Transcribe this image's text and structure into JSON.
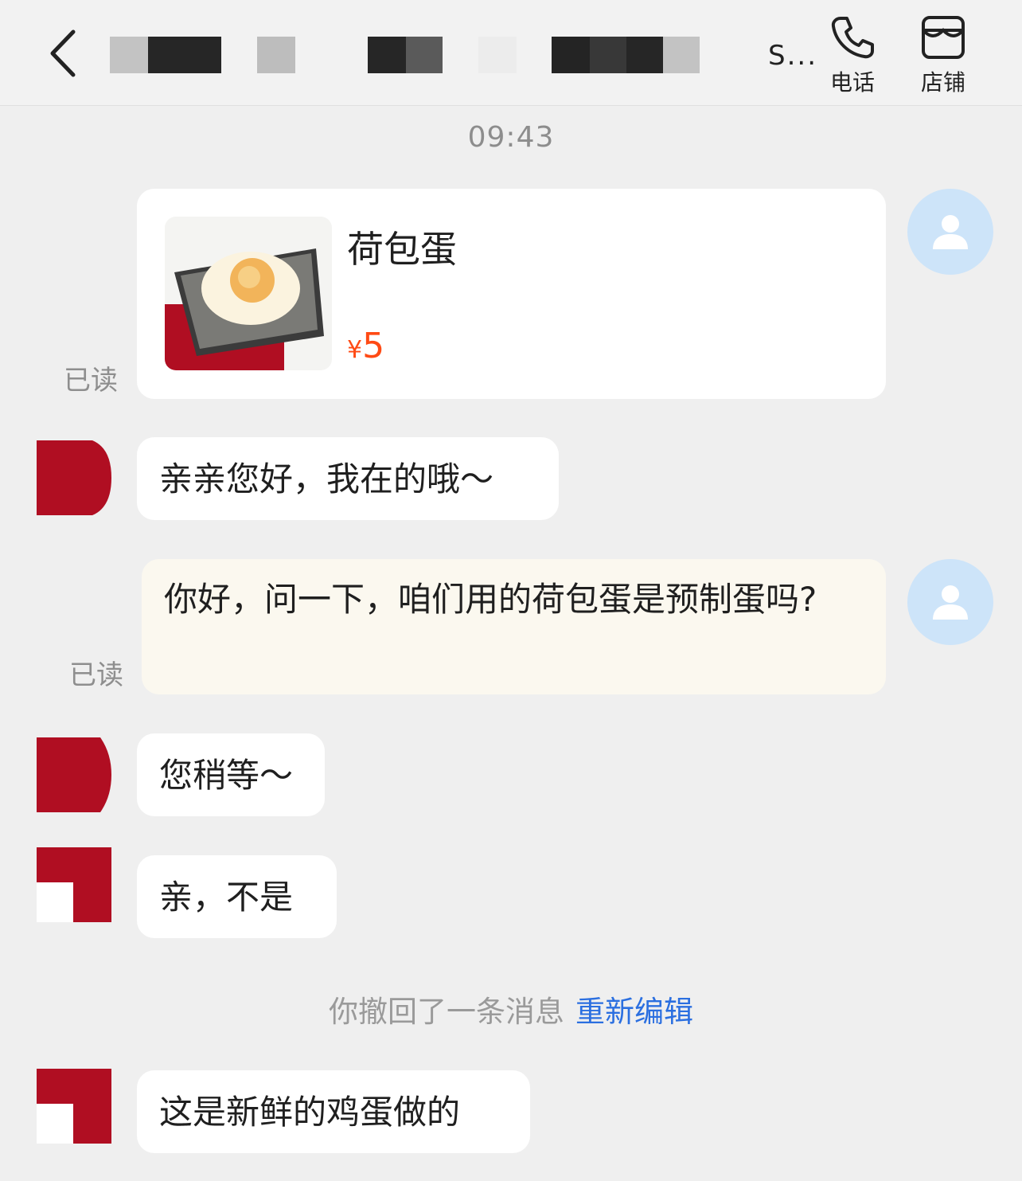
{
  "header": {
    "title": "S...",
    "actions": [
      {
        "label": "电话",
        "icon": "phone-icon"
      },
      {
        "label": "店铺",
        "icon": "store-icon"
      }
    ]
  },
  "chat": {
    "time": "09:43",
    "read_label": "已读",
    "product": {
      "name": "荷包蛋",
      "currency": "¥",
      "price": "5"
    },
    "messages": [
      {
        "from": "shop",
        "text": "亲亲您好，我在的哦～"
      },
      {
        "from": "me",
        "text": "你好，问一下，咱们用的荷包蛋是预制蛋吗?"
      },
      {
        "from": "shop",
        "text": "您稍等～"
      },
      {
        "from": "shop",
        "text": "亲，不是"
      },
      {
        "from": "shop",
        "text": "这是新鲜的鸡蛋做的"
      }
    ],
    "recall_notice": {
      "text": "你撤回了一条消息",
      "link": "重新编辑"
    }
  },
  "colors": {
    "accent_link": "#2b6fe0",
    "price": "#ff4a14",
    "my_bubble": "#fbf8ef",
    "user_avatar": "#cde4f9",
    "shop_avatar": "#b00e22"
  }
}
